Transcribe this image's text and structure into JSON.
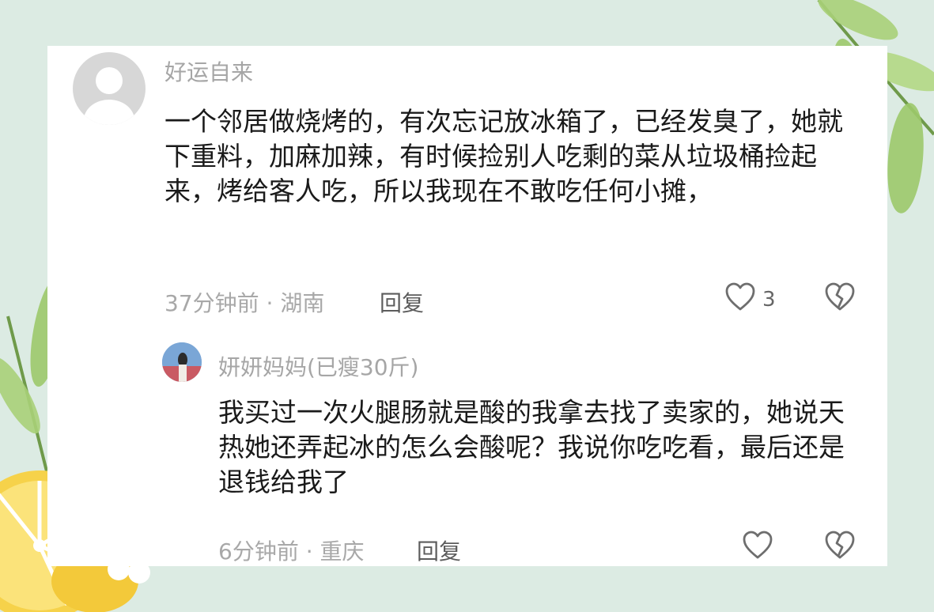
{
  "comments": [
    {
      "username": "好运自来",
      "text": "一个邻居做烧烤的，有次忘记放冰箱了，已经发臭了，她就下重料，加麻加辣，有时候捡别人吃剩的菜从垃圾桶捡起来，烤给客人吃，所以我现在不敢吃任何小摊，",
      "meta": "37分钟前 · 湖南",
      "reply_label": "回复",
      "like_count": "3"
    },
    {
      "username": "妍妍妈妈(已瘦30斤)",
      "text": "我买过一次火腿肠就是酸的我拿去找了卖家的，她说天热她还弄起冰的怎么会酸呢？我说你吃吃看，最后还是退钱给我了",
      "meta": "6分钟前 · 重庆",
      "reply_label": "回复"
    }
  ],
  "colors": {
    "background": "#dcebe3",
    "card": "#ffffff",
    "username": "#a6a6a6",
    "text": "#1a1a1a",
    "meta": "#a8a8a8",
    "icon": "#6e6e6e",
    "lemon": "#f6d24a",
    "leaf": "#9cc96a"
  },
  "icons": {
    "like": "heart-outline-icon",
    "dislike": "broken-heart-icon",
    "default_avatar": "person-silhouette-icon"
  }
}
